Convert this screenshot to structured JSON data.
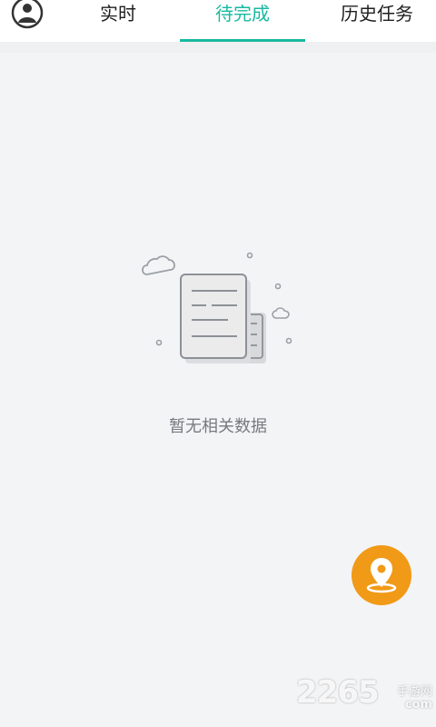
{
  "tabs": [
    {
      "label": "实时"
    },
    {
      "label": "待完成"
    },
    {
      "label": "历史任务"
    }
  ],
  "active_tab": "待完成",
  "empty_state": {
    "message": "暂无相关数据",
    "icon": "empty-document-icon"
  },
  "fab": {
    "icon": "location-pin-icon"
  },
  "watermark": {
    "main": "2265",
    "small_top": "手游网",
    "small_bottom": "com"
  },
  "colors": {
    "accent": "#19b9a0",
    "fab": "#f19a17",
    "background": "#f3f4f6"
  }
}
